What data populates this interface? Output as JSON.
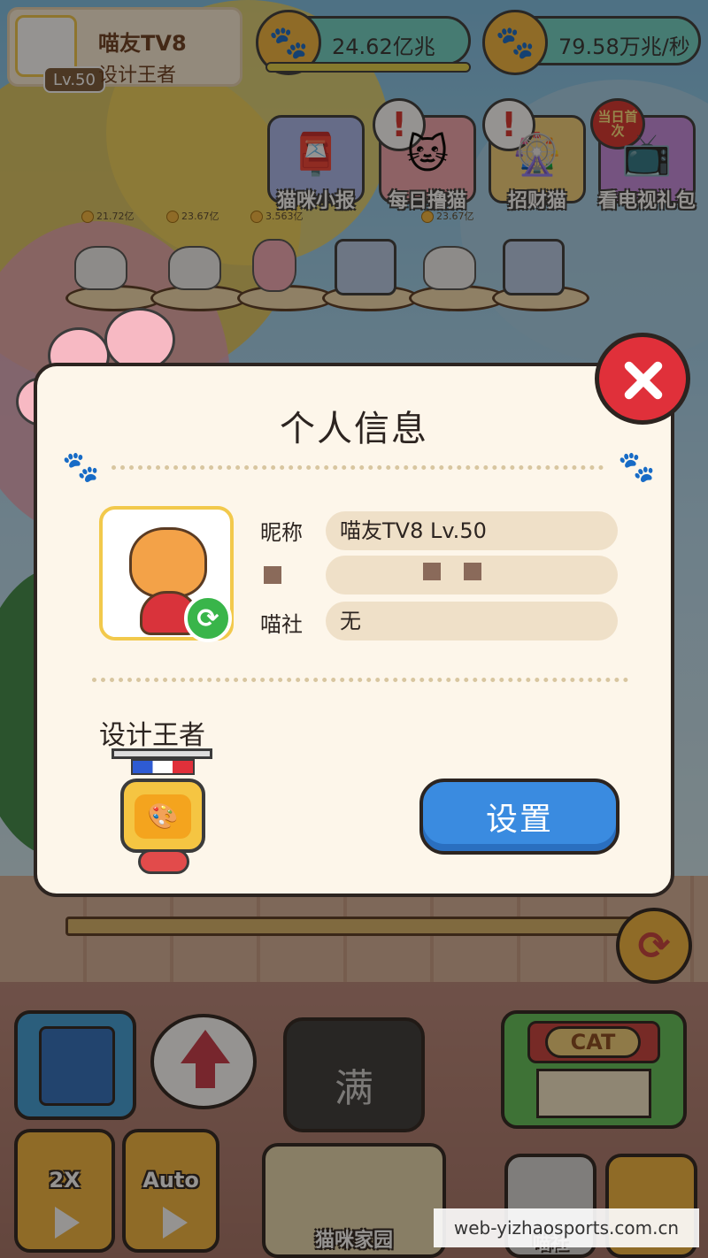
{
  "profile": {
    "name": "喵友TV8",
    "title": "设计王者",
    "level": "Lv.50"
  },
  "currencies": [
    {
      "icon": "paw-coin-icon",
      "value": "24.62亿兆"
    },
    {
      "icon": "paw-coin-icon",
      "value": "79.58万兆/秒"
    }
  ],
  "menu": [
    {
      "label": "猫咪小报",
      "icon": "mailbox-icon",
      "alert": ""
    },
    {
      "label": "每日撸猫",
      "icon": "cat-pet-icon",
      "alert": "!"
    },
    {
      "label": "招财猫",
      "icon": "fortune-wheel-icon",
      "alert": "!"
    },
    {
      "label": "看电视礼包",
      "icon": "tv-icon",
      "badge": "当日首次"
    }
  ],
  "earnings": [
    "21.72亿",
    "23.67亿",
    "3.563亿",
    "23.67亿"
  ],
  "modal": {
    "title": "个人信息",
    "nickname_label": "昵称",
    "nickname_value": "喵友TV8 Lv.50",
    "society_label": "喵社",
    "society_value": "无",
    "medal_title": "设计王者",
    "settings_button": "设置"
  },
  "bottom": {
    "full_label": "满",
    "shop_sign": "CAT",
    "speed_label": "2X",
    "auto_label": "Auto",
    "map_label": "猫咪家园",
    "society_label": "喵社"
  },
  "watermark": "web-yizhaosports.com.cn",
  "colors": {
    "close": "#e0303a",
    "settings": "#3a8be0",
    "modal_bg": "#fdf6ea"
  }
}
